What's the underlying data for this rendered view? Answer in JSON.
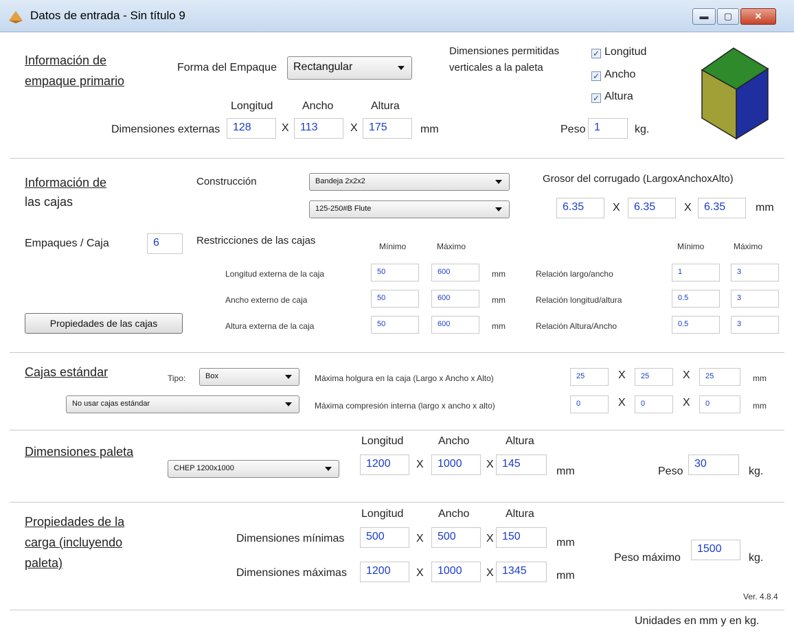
{
  "window": {
    "title": "Datos de entrada - Sin título 9"
  },
  "primary": {
    "title_line1": "Información de",
    "title_line2": "empaque primario",
    "shape_label": "Forma del Empaque",
    "shape_value": "Rectangular",
    "allowed_label_line1": "Dimensiones permitidas",
    "allowed_label_line2": "verticales a la paleta",
    "checks": [
      {
        "label": "Longitud",
        "checked": true
      },
      {
        "label": "Ancho",
        "checked": true
      },
      {
        "label": "Altura",
        "checked": true
      }
    ],
    "col_longitud": "Longitud",
    "col_ancho": "Ancho",
    "col_altura": "Altura",
    "dims_label": "Dimensiones externas",
    "length": "128",
    "width": "113",
    "height": "175",
    "x_sep": "X",
    "unit_mm": "mm",
    "weight_label": "Peso",
    "weight": "1",
    "unit_kg": "kg."
  },
  "boxes": {
    "title_line1": "Información de",
    "title_line2": "las cajas",
    "construction_label": "Construcción",
    "construction_value": "Bandeja 2x2x2",
    "flute_value": "125-250#B Flute",
    "thickness_label": "Grosor del corrugado (LargoxAnchoxAlto)",
    "thickness": [
      "6.35",
      "6.35",
      "6.35"
    ],
    "per_box_label": "Empaques / Caja",
    "per_box": "6",
    "restrictions_label": "Restricciones de las cajas",
    "min_label": "Mínimo",
    "max_label": "Máximo",
    "rows": [
      {
        "label": "Longitud externa de la caja",
        "min": "50",
        "max": "600",
        "ratio_label": "Relación largo/ancho",
        "rmin": "1",
        "rmax": "3"
      },
      {
        "label": "Ancho externo de caja",
        "min": "50",
        "max": "600",
        "ratio_label": "Relación longitud/altura",
        "rmin": "0.5",
        "rmax": "3"
      },
      {
        "label": "Altura externa de la caja",
        "min": "50",
        "max": "600",
        "ratio_label": "Relación Altura/Ancho",
        "rmin": "0.5",
        "rmax": "3"
      }
    ],
    "props_button": "Propiedades de las cajas"
  },
  "standard": {
    "title": "Cajas estándar",
    "type_label": "Tipo:",
    "type_value": "Box",
    "use_value": "No usar cajas estándar",
    "clearance_label": "Máxima holgura en la caja (Largo x Ancho x Alto)",
    "clearance": [
      "25",
      "25",
      "25"
    ],
    "compression_label": "Máxima compresión interna (largo x ancho x alto)",
    "compression": [
      "0",
      "0",
      "0"
    ]
  },
  "pallet": {
    "title": "Dimensiones paleta",
    "type_value": "CHEP 1200x1000",
    "length": "1200",
    "width": "1000",
    "height": "145",
    "weight": "30"
  },
  "load": {
    "title_line1": "Propiedades de la",
    "title_line2": "carga (incluyendo",
    "title_line3": "paleta)",
    "min_label": "Dimensiones mínimas",
    "min": [
      "500",
      "500",
      "150"
    ],
    "max_label": "Dimensiones máximas",
    "max": [
      "1200",
      "1000",
      "1345"
    ],
    "max_weight_label": "Peso máximo",
    "max_weight": "1500",
    "version": "Ver. 4.8.4"
  },
  "footer": {
    "units_note": "Unidades en mm y en kg."
  },
  "colors": {
    "cube_top": "#2f8a2b",
    "cube_left": "#a0a037",
    "cube_right": "#1f2fa0",
    "value_blue": "#1a3ccc"
  }
}
